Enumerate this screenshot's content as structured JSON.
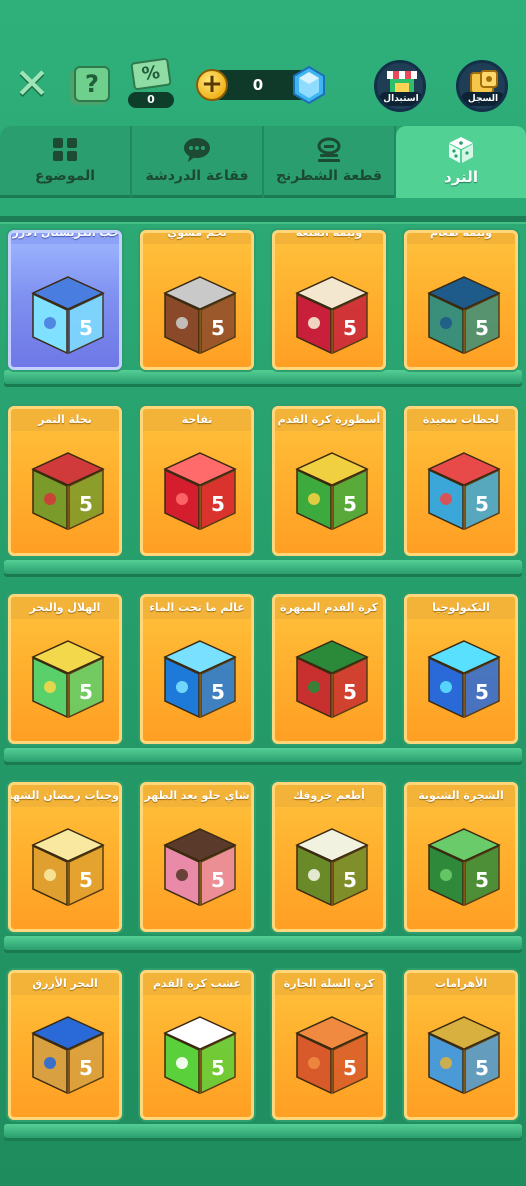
{
  "header": {
    "coupon_count": "0",
    "coupon_symbol": "%",
    "help_symbol": "?",
    "close_symbol": "✕",
    "currency_amount": "0",
    "currency_plus": "+",
    "swap_label": "استبدال",
    "history_label": "السجل"
  },
  "tabs": [
    {
      "label": "الموضوع",
      "icon": "grid-icon",
      "active": false
    },
    {
      "label": "فقاعة الدردشة",
      "icon": "chat-bubble-icon",
      "active": false
    },
    {
      "label": "قطعة الشطرنج",
      "icon": "chess-piece-icon",
      "active": false
    },
    {
      "label": "النرد",
      "icon": "dice-icon",
      "active": true
    }
  ],
  "rows": [
    [
      {
        "name": "وليمة طعام",
        "theme": "food-feast"
      },
      {
        "name": "وليمة القلعة",
        "theme": "castle-feast"
      },
      {
        "name": "لحم مشوي",
        "theme": "grilled-meat"
      },
      {
        "name": "حب الكريستال الأزرق",
        "theme": "blue-crystal-love",
        "selected": true
      }
    ],
    [
      {
        "name": "لحظات سعيدة",
        "theme": "carousel"
      },
      {
        "name": "أسطورة كرة القدم",
        "theme": "football-legend"
      },
      {
        "name": "تفاحة",
        "theme": "apple"
      },
      {
        "name": "نخلة التمر",
        "theme": "date-palm"
      }
    ],
    [
      {
        "name": "التكنولوجيا",
        "theme": "technology"
      },
      {
        "name": "كرة القدم المبهرة",
        "theme": "dazzling-football"
      },
      {
        "name": "عالم ما تحت الماء",
        "theme": "underwater"
      },
      {
        "name": "الهلال والبحر",
        "theme": "crescent-sea"
      }
    ],
    [
      {
        "name": "الشجرة الشتوية",
        "theme": "winter-tree"
      },
      {
        "name": "أطعم خروفك",
        "theme": "sheep"
      },
      {
        "name": "شاي حلو بعد الظهر",
        "theme": "afternoon-tea"
      },
      {
        "name": "وجبات رمضان الشهية",
        "theme": "ramadan-lantern"
      }
    ],
    [
      {
        "name": "الأهرامات",
        "theme": "pyramids"
      },
      {
        "name": "كرة السلة الحارة",
        "theme": "basketball"
      },
      {
        "name": "عشب كرة القدم",
        "theme": "football-grass"
      },
      {
        "name": "البحر الأزرق",
        "theme": "blue-sea"
      }
    ]
  ],
  "colors": {
    "background": "#2a9e6f",
    "tab_active": "#52d194",
    "card_orange": "#ffb12e",
    "card_selected": "#7e8ff0",
    "shelf": "#55cf95"
  }
}
